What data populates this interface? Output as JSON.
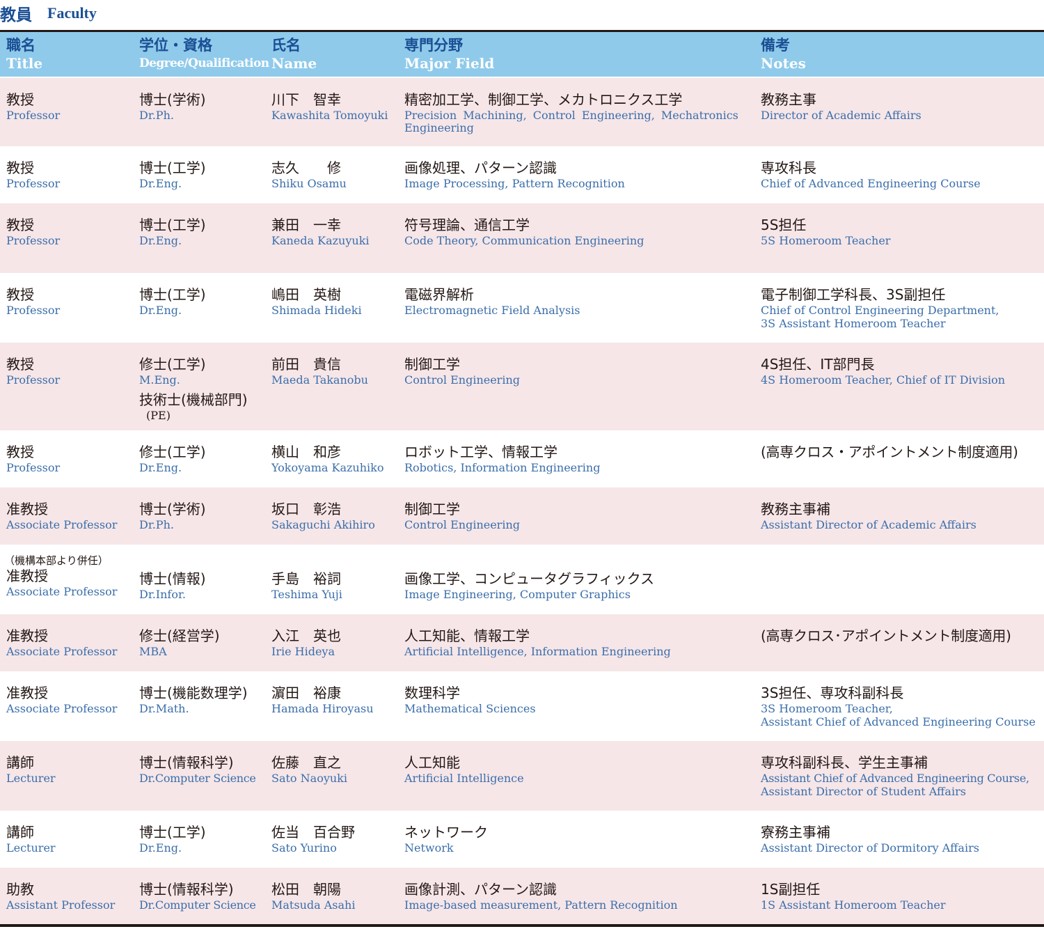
{
  "heading": {
    "ja": "教員",
    "en": "Faculty"
  },
  "columns": [
    {
      "ja": "職名",
      "en": "Title"
    },
    {
      "ja": "学位・資格",
      "en": "Degree/Qualification"
    },
    {
      "ja": "氏名",
      "en": "Name"
    },
    {
      "ja": "専門分野",
      "en": "Major Field"
    },
    {
      "ja": "備考",
      "en": "Notes"
    }
  ],
  "rows": [
    {
      "title_ja": "教授",
      "title_en": "Professor",
      "degree_ja": "博士(学術)",
      "degree_en": "Dr.Ph.",
      "name_ja": "川下　智幸",
      "name_en": "Kawashita Tomoyuki",
      "field_ja": "精密加工学、制御工学、メカトロニクス工学",
      "field_en": "Precision Machining, Control Engineering, Mechatronics Engineering",
      "notes_ja": "教務主事",
      "notes_en": "Director of Academic Affairs"
    },
    {
      "title_ja": "教授",
      "title_en": "Professor",
      "degree_ja": "博士(工学)",
      "degree_en": "Dr.Eng.",
      "name_ja": "志久　　修",
      "name_en": "Shiku Osamu",
      "field_ja": "画像処理、パターン認識",
      "field_en": "Image Processing, Pattern Recognition",
      "notes_ja": "専攻科長",
      "notes_en": "Chief of Advanced Engineering Course"
    },
    {
      "title_ja": "教授",
      "title_en": "Professor",
      "degree_ja": "博士(工学)",
      "degree_en": "Dr.Eng.",
      "name_ja": "兼田　一幸",
      "name_en": "Kaneda Kazuyuki",
      "field_ja": "符号理論、通信工学",
      "field_en": "Code Theory, Communication Engineering",
      "notes_ja": "5S担任",
      "notes_en": "5S Homeroom Teacher"
    },
    {
      "title_ja": "教授",
      "title_en": "Professor",
      "degree_ja": "博士(工学)",
      "degree_en": "Dr.Eng.",
      "name_ja": "嶋田　英樹",
      "name_en": "Shimada Hideki",
      "field_ja": "電磁界解析",
      "field_en": "Electromagnetic Field Analysis",
      "notes_ja": "電子制御工学科長、3S副担任",
      "notes_en": "Chief of Control Engineering Department,",
      "notes_en2": "3S Assistant Homeroom Teacher"
    },
    {
      "title_ja": "教授",
      "title_en": "Professor",
      "degree_ja": "修士(工学)",
      "degree_en": "M.Eng.",
      "degree_ja2": "技術士(機械部門)",
      "degree_en2": "(PE)",
      "name_ja": "前田　貴信",
      "name_en": "Maeda Takanobu",
      "field_ja": "制御工学",
      "field_en": "Control Engineering",
      "notes_ja": "4S担任、IT部門長",
      "notes_en": "4S Homeroom Teacher, Chief of IT Division"
    },
    {
      "title_ja": "教授",
      "title_en": "Professor",
      "degree_ja": "修士(工学)",
      "degree_en": "Dr.Eng.",
      "name_ja": "横山　和彦",
      "name_en": "Yokoyama Kazuhiko",
      "field_ja": "ロボット工学、情報工学",
      "field_en": "Robotics,  Information Engineering",
      "notes_ja": "(高専クロス・アポイントメント制度適用)"
    },
    {
      "title_ja": "准教授",
      "title_en": "Associate Professor",
      "degree_ja": "博士(学術)",
      "degree_en": "Dr.Ph.",
      "name_ja": "坂口　彰浩",
      "name_en": "Sakaguchi Akihiro",
      "field_ja": "制御工学",
      "field_en": "Control Engineering",
      "notes_ja": "教務主事補",
      "notes_en": "Assistant Director of Academic Affairs"
    },
    {
      "title_pre": "（機構本部より併任）",
      "title_ja": "准教授",
      "title_en": "Associate Professor",
      "degree_ja": "博士(情報)",
      "degree_en": "Dr.Infor.",
      "name_ja": "手島　裕詞",
      "name_en": "Teshima Yuji",
      "field_ja": "画像工学、コンピュータグラフィックス",
      "field_en": "Image Engineering, Computer Graphics"
    },
    {
      "title_ja": "准教授",
      "title_en": "Associate Professor",
      "degree_ja": "修士(経営学)",
      "degree_en": "MBA",
      "name_ja": "入江　英也",
      "name_en": "Irie Hideya",
      "field_ja": "人工知能、情報工学",
      "field_en": "Artificial Intelligence, Information Engineering",
      "notes_ja": "(高専クロス･アポイントメント制度適用)"
    },
    {
      "title_ja": "准教授",
      "title_en": "Associate Professor",
      "degree_ja": "博士(機能数理学)",
      "degree_en": "Dr.Math.",
      "name_ja": "濵田　裕康",
      "name_en": "Hamada Hiroyasu",
      "field_ja": "数理科学",
      "field_en": "Mathematical Sciences",
      "notes_ja": "3S担任、専攻科副科長",
      "notes_en": "3S Homeroom Teacher,",
      "notes_en2": "Assistant Chief of Advanced Engineering Course"
    },
    {
      "title_ja": "講師",
      "title_en": "Lecturer",
      "degree_ja": "博士(情報科学)",
      "degree_en": "Dr.Computer Science",
      "name_ja": "佐藤　直之",
      "name_en": "Sato Naoyuki",
      "field_ja": "人工知能",
      "field_en": "Artificial Intelligence",
      "notes_ja": "専攻科副科長、学生主事補",
      "notes_en": "Assistant Chief of Advanced Engineering Course,",
      "notes_en2": "Assistant Director of Student Affairs"
    },
    {
      "title_ja": "講師",
      "title_en": "Lecturer",
      "degree_ja": "博士(工学)",
      "degree_en": "Dr.Eng.",
      "name_ja": "佐当　百合野",
      "name_en": "Sato Yurino",
      "field_ja": "ネットワーク",
      "field_en": "Network",
      "notes_ja": "寮務主事補",
      "notes_en": "Assistant Director of Dormitory Affairs"
    },
    {
      "title_ja": "助教",
      "title_en": "Assistant Professor",
      "degree_ja": "博士(情報科学)",
      "degree_en": "Dr.Computer Science",
      "name_ja": "松田　朝陽",
      "name_en": "Matsuda Asahi",
      "field_ja": "画像計測、パターン認識",
      "field_en": "Image-based measurement, Pattern Recognition",
      "notes_ja": "1S副担任",
      "notes_en": "1S Assistant Homeroom Teacher"
    }
  ]
}
